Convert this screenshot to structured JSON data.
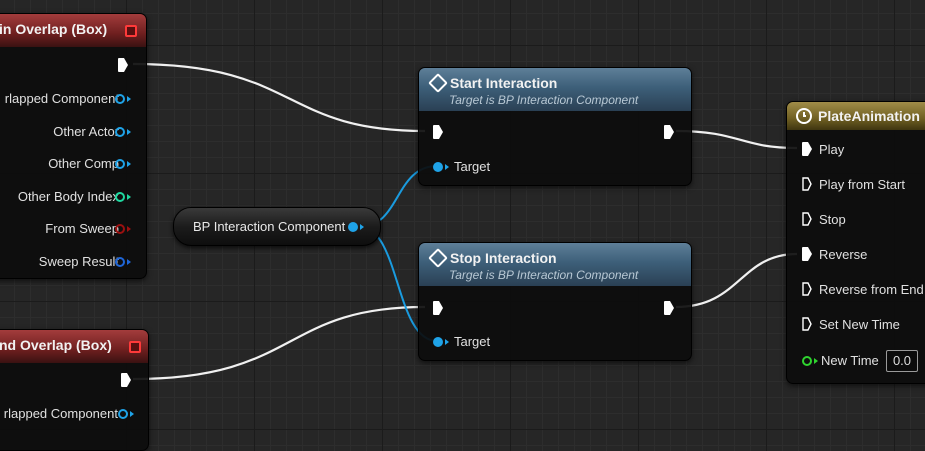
{
  "nodes": {
    "begin_overlap": {
      "title": "in Overlap (Box)",
      "pins": [
        "rlapped Component",
        "Other Actor",
        "Other Comp",
        "Other Body Index",
        "From Sweep",
        "Sweep Result"
      ]
    },
    "end_overlap": {
      "title": "nd Overlap (Box)",
      "pins": [
        "rlapped Component"
      ]
    },
    "variable": {
      "label": "BP Interaction Component"
    },
    "start_interaction": {
      "title": "Start Interaction",
      "subtitle": "Target is BP Interaction Component",
      "target_label": "Target"
    },
    "stop_interaction": {
      "title": "Stop Interaction",
      "subtitle": "Target is BP Interaction Component",
      "target_label": "Target"
    },
    "plate_animation": {
      "title": "PlateAnimation",
      "pins": [
        "Play",
        "Play from Start",
        "Stop",
        "Reverse",
        "Reverse from End",
        "Set New Time",
        "New Time"
      ],
      "new_time_value": "0.0"
    }
  },
  "icons": {
    "event_icon": "red-square-icon",
    "function_icon": "function-diamond-icon",
    "timeline_icon": "clock-icon"
  },
  "colors": {
    "object_pin": "#1fa3e8",
    "int_pin": "#1fd8a0",
    "bool_pin": "#9b1010",
    "struct_pin": "#1f66d8",
    "float_pin": "#2fd42f",
    "exec_wire": "#ffffff"
  }
}
